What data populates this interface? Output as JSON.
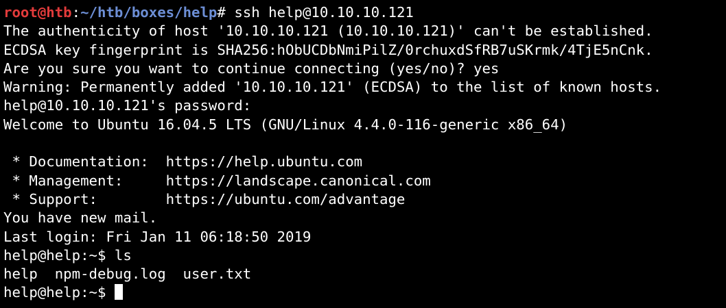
{
  "colors": {
    "background": "#000000",
    "text": "#ffffff",
    "root_user": "#e23b3b",
    "root_path": "#6d8fd6"
  },
  "prompt": {
    "root_user": "root@htb",
    "separator": ":",
    "root_path": "~/htb/boxes/help",
    "root_symbol": "# ",
    "command": "ssh help@10.10.10.121"
  },
  "output": [
    "The authenticity of host '10.10.10.121 (10.10.10.121)' can't be established.",
    "ECDSA key fingerprint is SHA256:hObUCDbNmiPilZ/0rchuxdSfRB7uSKrmk/4TjE5nCnk.",
    "Are you sure you want to continue connecting (yes/no)? yes",
    "Warning: Permanently added '10.10.10.121' (ECDSA) to the list of known hosts.",
    "help@10.10.10.121's password: ",
    "Welcome to Ubuntu 16.04.5 LTS (GNU/Linux 4.4.0-116-generic x86_64)",
    "",
    " * Documentation:  https://help.ubuntu.com",
    " * Management:     https://landscape.canonical.com",
    " * Support:        https://ubuntu.com/advantage",
    "You have new mail.",
    "Last login: Fri Jan 11 06:18:50 2019",
    "help@help:~$ ls",
    "help  npm-debug.log  user.txt",
    "help@help:~$ "
  ]
}
